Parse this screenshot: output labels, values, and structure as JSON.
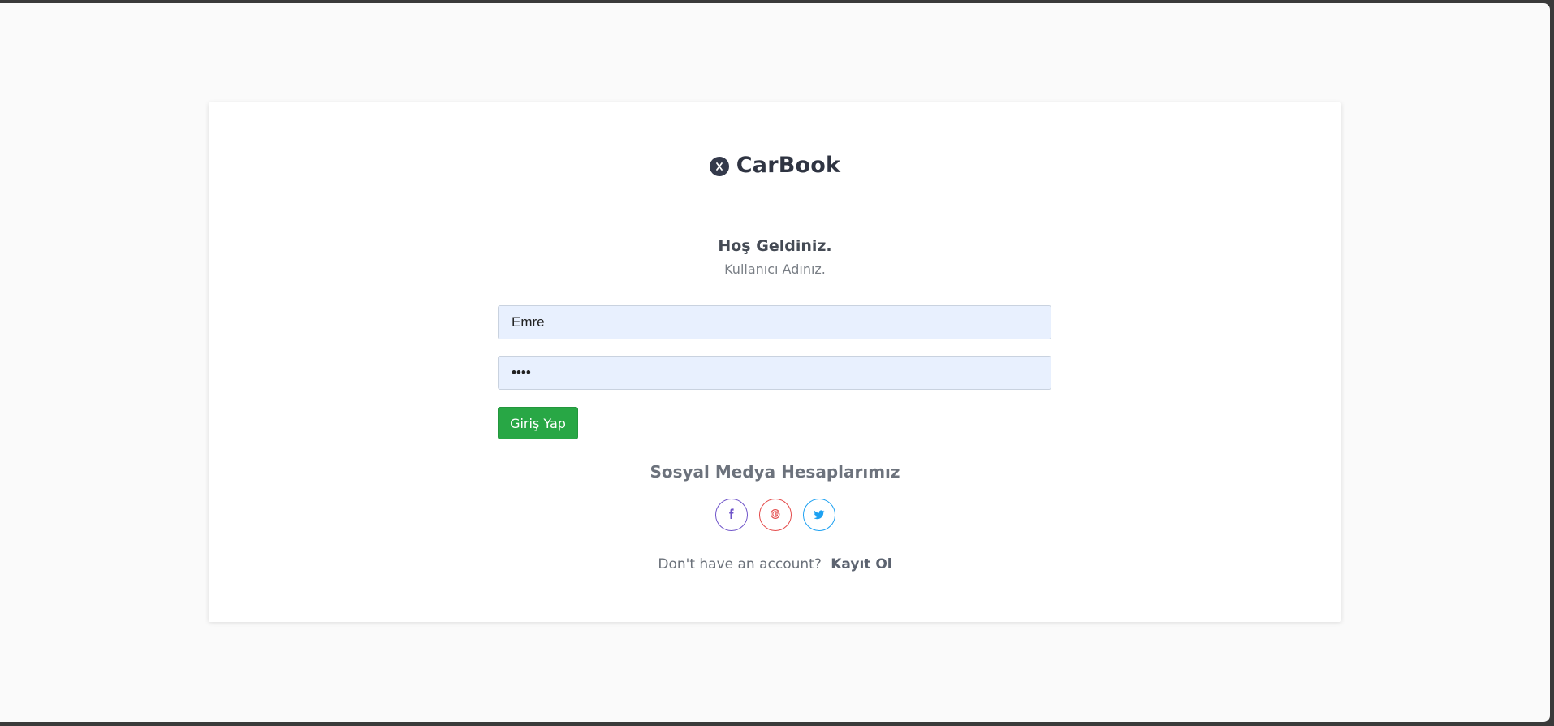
{
  "brand": {
    "name": "CarBook",
    "icon": "car-logo-icon"
  },
  "login": {
    "welcome_title": "Hoş Geldiniz.",
    "subtitle": "Kullanıcı Adınız.",
    "username_value": "Emre",
    "password_value": "1234",
    "submit_label": "Giriş Yap"
  },
  "social": {
    "title": "Sosyal Medya Hesaplarımız",
    "buttons": [
      {
        "icon": "facebook-icon",
        "color": "#6f54c9"
      },
      {
        "icon": "google-icon",
        "color": "#e44a4a"
      },
      {
        "icon": "twitter-icon",
        "color": "#1da1f2"
      }
    ]
  },
  "signup": {
    "prompt": "Don't have an account?",
    "link_label": "Kayıt Ol"
  },
  "colors": {
    "primary_button": "#28a745",
    "input_background": "#e8f0fe",
    "page_background": "#fafafa"
  }
}
